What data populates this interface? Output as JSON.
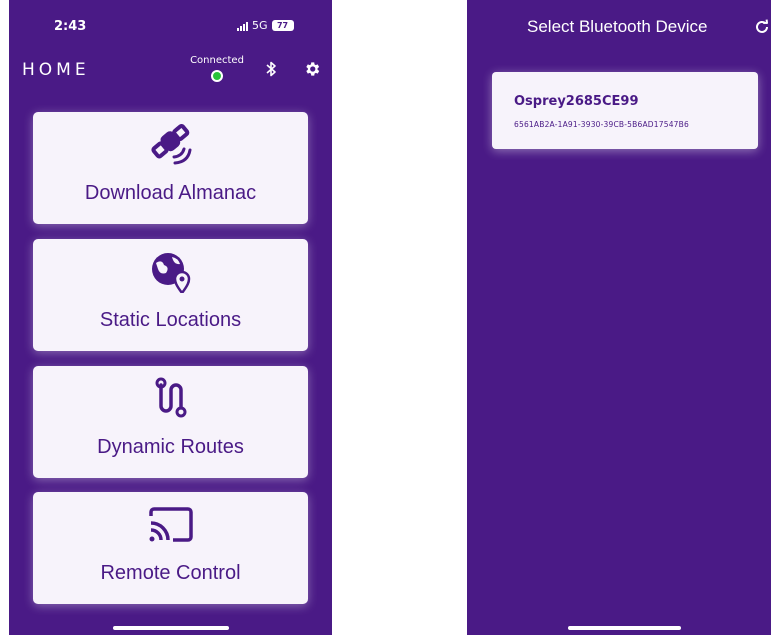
{
  "left_screen": {
    "status": {
      "time": "2:43",
      "network": "5G",
      "battery": "77"
    },
    "header": {
      "title": "HOME",
      "connection_label": "Connected",
      "connection_color": "#28c23a"
    },
    "menu": [
      {
        "label": "Download Almanac",
        "icon": "satellite-icon"
      },
      {
        "label": "Static Locations",
        "icon": "globe-pin-icon"
      },
      {
        "label": "Dynamic Routes",
        "icon": "route-icon"
      },
      {
        "label": "Remote Control",
        "icon": "cast-icon"
      }
    ]
  },
  "right_screen": {
    "title": "Select Bluetooth Device",
    "device": {
      "name": "Osprey2685CE99",
      "id": "6561AB2A-1A91-3930-39CB-5B6AD17547B6"
    }
  },
  "colors": {
    "background": "#4a1a86",
    "card": "#f7f3fb",
    "accent": "#4a1a86"
  }
}
